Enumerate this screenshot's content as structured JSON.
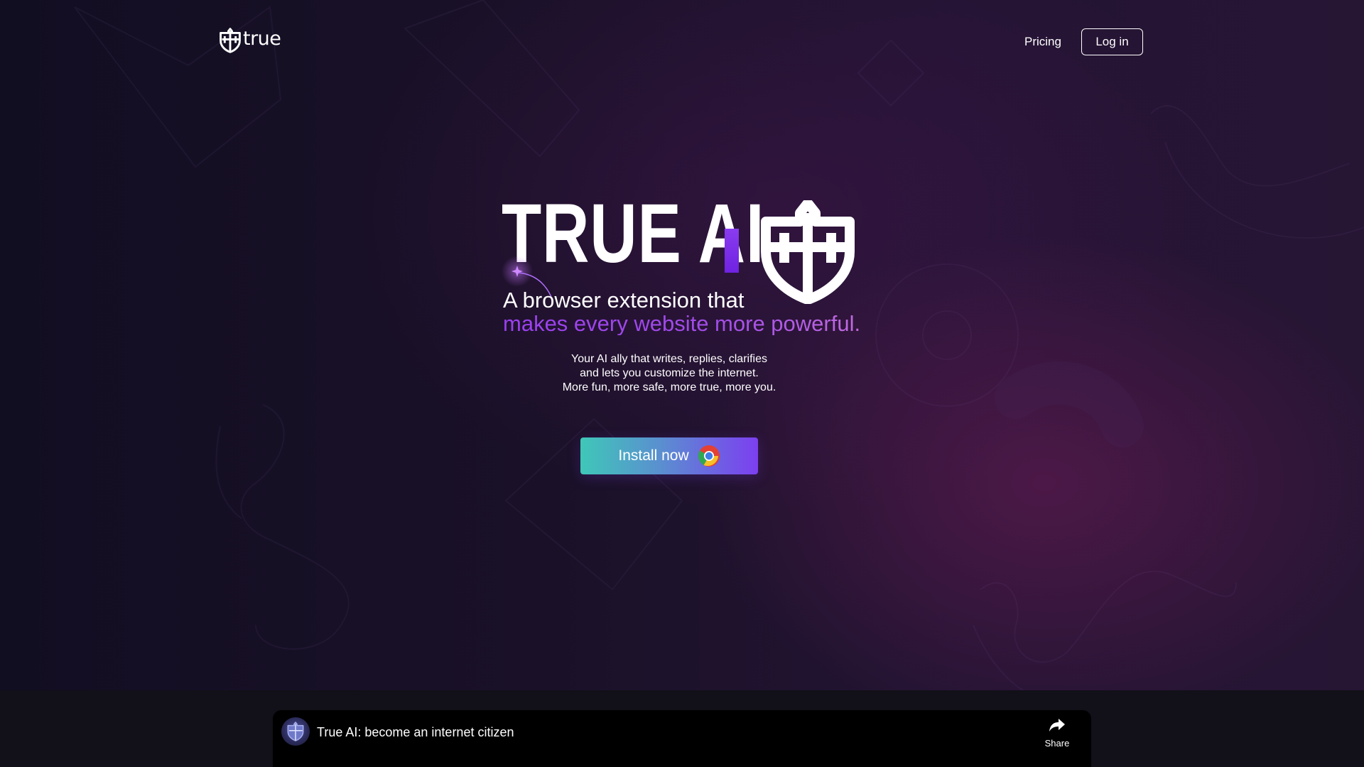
{
  "colors": {
    "background": "#1a1128",
    "accent_purple": "#8a3cf0",
    "accent_teal": "#3fc7b8",
    "text": "#ffffff"
  },
  "header": {
    "logo_text": "true",
    "logo_icon": "true-shield-icon",
    "nav": {
      "pricing_label": "Pricing",
      "login_label": "Log in"
    }
  },
  "hero": {
    "title": "TRUE AI",
    "title_icon": "true-shield-icon",
    "subtitle_line1": "A browser extension that",
    "subtitle_line2": "makes every website more powerful.",
    "description": [
      "Your AI ally that writes, replies, clarifies",
      "and lets you customize the internet.",
      "More fun, more safe, more true, more you."
    ],
    "install_label": "Install now",
    "install_icon": "chrome-icon"
  },
  "video": {
    "title": "True AI: become an internet citizen",
    "share_label": "Share",
    "share_icon": "share-arrow-icon",
    "avatar_icon": "channel-avatar-icon"
  }
}
